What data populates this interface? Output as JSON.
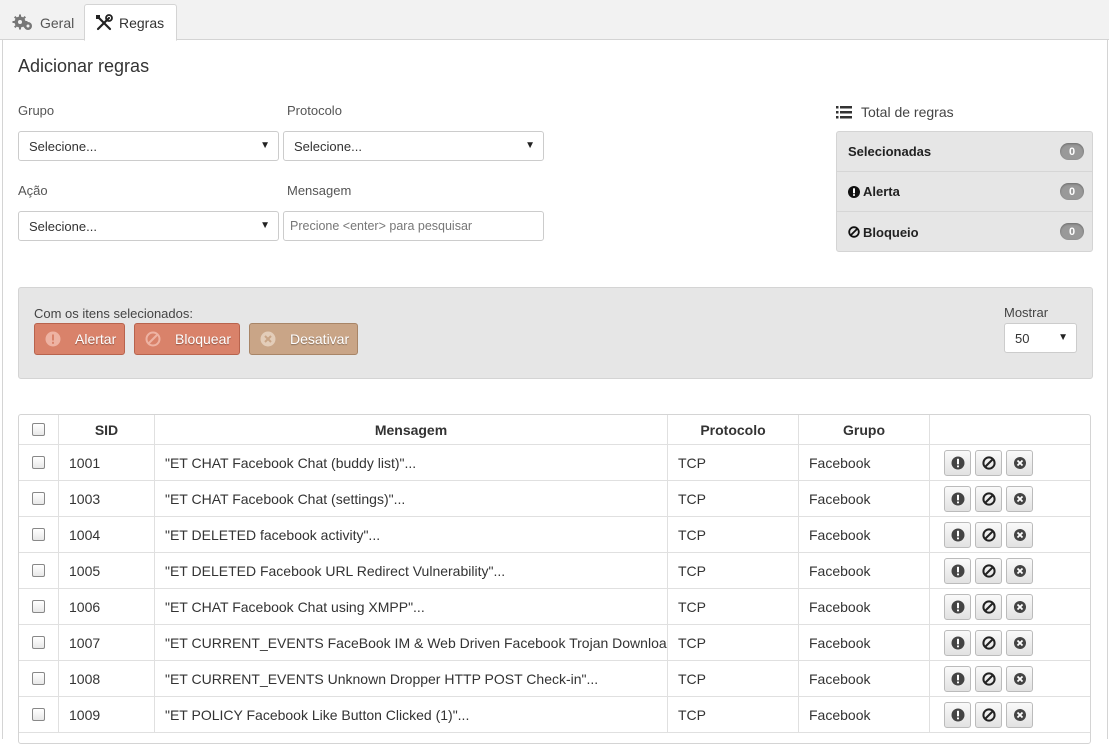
{
  "tabs": [
    {
      "label": "Geral",
      "icon": "gears-icon"
    },
    {
      "label": "Regras",
      "icon": "tools-icon"
    }
  ],
  "page_title": "Adicionar regras",
  "filters": {
    "grupo": {
      "label": "Grupo",
      "value": "Selecione..."
    },
    "protocolo": {
      "label": "Protocolo",
      "value": "Selecione..."
    },
    "acao": {
      "label": "Ação",
      "value": "Selecione..."
    },
    "mensagem": {
      "label": "Mensagem",
      "placeholder": "Precione <enter> para pesquisar"
    }
  },
  "totals": {
    "title": "Total de regras",
    "rows": [
      {
        "label": "Selecionadas",
        "count": "0"
      },
      {
        "label": "Alerta",
        "count": "0"
      },
      {
        "label": "Bloqueio",
        "count": "0"
      }
    ]
  },
  "bulk": {
    "label": "Com os itens selecionados:",
    "alert": "Alertar",
    "block": "Bloquear",
    "disable": "Desativar",
    "show_label": "Mostrar",
    "show_value": "50"
  },
  "table": {
    "headers": [
      "SID",
      "Mensagem",
      "Protocolo",
      "Grupo"
    ],
    "rows": [
      {
        "sid": "1001",
        "msg": "\"ET CHAT Facebook Chat (buddy list)\"...",
        "proto": "TCP",
        "group": "Facebook"
      },
      {
        "sid": "1003",
        "msg": "\"ET CHAT Facebook Chat (settings)\"...",
        "proto": "TCP",
        "group": "Facebook"
      },
      {
        "sid": "1004",
        "msg": "\"ET DELETED facebook activity\"...",
        "proto": "TCP",
        "group": "Facebook"
      },
      {
        "sid": "1005",
        "msg": "\"ET DELETED Facebook URL Redirect Vulnerability\"...",
        "proto": "TCP",
        "group": "Facebook"
      },
      {
        "sid": "1006",
        "msg": "\"ET CHAT Facebook Chat using XMPP\"...",
        "proto": "TCP",
        "group": "Facebook"
      },
      {
        "sid": "1007",
        "msg": "\"ET CURRENT_EVENTS FaceBook IM & Web Driven Facebook Trojan Download\"...",
        "proto": "TCP",
        "group": "Facebook"
      },
      {
        "sid": "1008",
        "msg": "\"ET CURRENT_EVENTS Unknown Dropper HTTP POST Check-in\"...",
        "proto": "TCP",
        "group": "Facebook"
      },
      {
        "sid": "1009",
        "msg": "\"ET POLICY Facebook Like Button Clicked (1)\"...",
        "proto": "TCP",
        "group": "Facebook"
      }
    ]
  }
}
